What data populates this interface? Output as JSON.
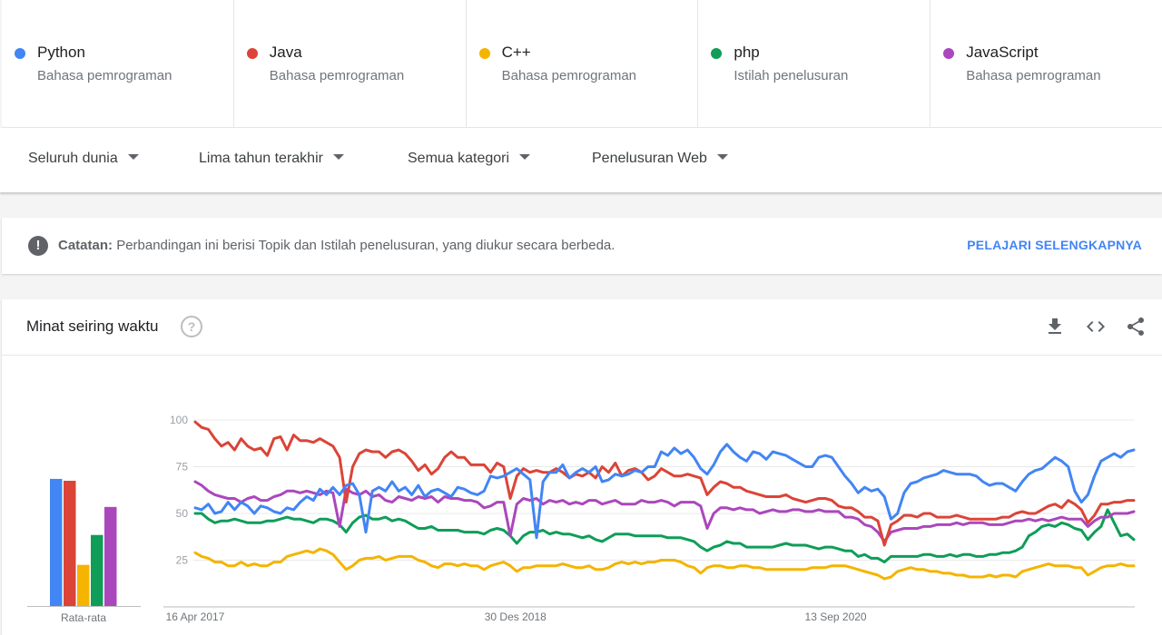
{
  "compare": {
    "terms": [
      {
        "name": "Python",
        "type": "Bahasa pemrograman",
        "color": "#4285f4"
      },
      {
        "name": "Java",
        "type": "Bahasa pemrograman",
        "color": "#db4437"
      },
      {
        "name": "C++",
        "type": "Bahasa pemrograman",
        "color": "#f4b400"
      },
      {
        "name": "php",
        "type": "Istilah penelusuran",
        "color": "#0f9d58"
      },
      {
        "name": "JavaScript",
        "type": "Bahasa pemrograman",
        "color": "#ab47bc"
      }
    ]
  },
  "filters": {
    "region": "Seluruh dunia",
    "time": "Lima tahun terakhir",
    "category": "Semua kategori",
    "search_type": "Penelusuran Web"
  },
  "note": {
    "label": "Catatan:",
    "text": "Perbandingan ini berisi Topik dan Istilah penelusuran, yang diukur secara berbeda.",
    "link": "PELAJARI SELENGKAPNYA"
  },
  "card": {
    "title": "Minat seiring waktu",
    "help_glyph": "?"
  },
  "chart_data": {
    "type": "line",
    "title": "Minat seiring waktu",
    "ylim": [
      0,
      100
    ],
    "yticks": [
      25,
      50,
      75,
      100
    ],
    "grid": true,
    "x_range": [
      "16 Apr 2017",
      "16 Apr 2022"
    ],
    "x_tick_labels": [
      "16 Apr 2017",
      "30 Des 2018",
      "13 Sep 2020"
    ],
    "average": {
      "label": "Rata-rata",
      "values": [
        {
          "name": "Python",
          "value": 68
        },
        {
          "name": "Java",
          "value": 67
        },
        {
          "name": "C++",
          "value": 22
        },
        {
          "name": "php",
          "value": 38
        },
        {
          "name": "JavaScript",
          "value": 53
        }
      ]
    },
    "series": [
      {
        "name": "Python",
        "color": "#4285f4",
        "values": [
          53,
          52,
          55,
          50,
          51,
          56,
          52,
          56,
          54,
          50,
          54,
          53,
          51,
          50,
          53,
          52,
          56,
          59,
          57,
          63,
          60,
          64,
          60,
          65,
          66,
          60,
          40,
          62,
          64,
          62,
          67,
          62,
          64,
          60,
          65,
          59,
          62,
          63,
          61,
          59,
          64,
          63,
          61,
          60,
          62,
          70,
          69,
          70,
          72,
          74,
          71,
          68,
          37,
          67,
          72,
          72,
          76,
          69,
          72,
          74,
          72,
          75,
          67,
          68,
          71,
          70,
          71,
          73,
          72,
          75,
          75,
          83,
          81,
          85,
          82,
          84,
          80,
          74,
          71,
          76,
          83,
          87,
          83,
          80,
          78,
          83,
          82,
          79,
          83,
          82,
          81,
          79,
          77,
          75,
          75,
          80,
          81,
          80,
          75,
          70,
          66,
          61,
          64,
          62,
          63,
          59,
          47,
          50,
          61,
          66,
          67,
          69,
          70,
          71,
          73,
          72,
          71,
          71,
          71,
          70,
          67,
          65,
          66,
          66,
          64,
          62,
          67,
          71,
          73,
          74,
          77,
          80,
          78,
          75,
          62,
          56,
          60,
          70,
          78,
          80,
          82,
          80,
          83,
          84
        ]
      },
      {
        "name": "Java",
        "color": "#db4437",
        "values": [
          99,
          96,
          95,
          90,
          86,
          88,
          84,
          90,
          86,
          84,
          85,
          81,
          90,
          91,
          84,
          92,
          89,
          89,
          88,
          90,
          88,
          86,
          80,
          56,
          75,
          82,
          84,
          83,
          83,
          80,
          83,
          84,
          82,
          78,
          73,
          76,
          71,
          74,
          80,
          83,
          80,
          80,
          76,
          76,
          76,
          72,
          77,
          75,
          58,
          70,
          74,
          72,
          73,
          72,
          72,
          74,
          72,
          69,
          71,
          70,
          72,
          69,
          75,
          72,
          77,
          70,
          73,
          74,
          72,
          68,
          70,
          74,
          72,
          70,
          70,
          71,
          70,
          69,
          60,
          64,
          67,
          66,
          64,
          64,
          62,
          61,
          60,
          59,
          59,
          59,
          60,
          58,
          57,
          56,
          57,
          58,
          58,
          57,
          54,
          53,
          53,
          51,
          48,
          48,
          46,
          33,
          44,
          46,
          49,
          49,
          48,
          50,
          50,
          48,
          48,
          48,
          49,
          48,
          47,
          47,
          47,
          47,
          47,
          48,
          48,
          50,
          51,
          50,
          50,
          52,
          54,
          55,
          53,
          57,
          55,
          52,
          45,
          49,
          55,
          55,
          56,
          56,
          57,
          57
        ]
      },
      {
        "name": "C++",
        "color": "#f4b400",
        "values": [
          29,
          27,
          26,
          24,
          24,
          22,
          22,
          24,
          22,
          23,
          22,
          22,
          24,
          24,
          27,
          28,
          29,
          30,
          29,
          31,
          30,
          28,
          24,
          20,
          22,
          25,
          26,
          26,
          27,
          25,
          26,
          27,
          27,
          27,
          25,
          24,
          22,
          21,
          23,
          23,
          22,
          23,
          22,
          22,
          20,
          22,
          23,
          24,
          22,
          19,
          21,
          21,
          22,
          22,
          22,
          22,
          23,
          22,
          21,
          21,
          22,
          20,
          20,
          21,
          23,
          24,
          23,
          24,
          23,
          24,
          24,
          25,
          25,
          25,
          24,
          22,
          21,
          18,
          21,
          22,
          22,
          21,
          21,
          22,
          22,
          21,
          21,
          20,
          20,
          20,
          20,
          20,
          20,
          20,
          21,
          21,
          21,
          22,
          22,
          22,
          21,
          20,
          19,
          18,
          17,
          15,
          16,
          19,
          20,
          21,
          20,
          20,
          19,
          19,
          18,
          18,
          17,
          17,
          16,
          16,
          16,
          17,
          16,
          17,
          17,
          16,
          19,
          20,
          21,
          22,
          23,
          22,
          22,
          22,
          21,
          21,
          17,
          19,
          21,
          22,
          22,
          23,
          22,
          22
        ]
      },
      {
        "name": "php",
        "color": "#0f9d58",
        "values": [
          50,
          50,
          47,
          45,
          46,
          46,
          47,
          46,
          45,
          45,
          45,
          46,
          46,
          47,
          48,
          47,
          47,
          46,
          45,
          47,
          47,
          46,
          44,
          40,
          45,
          48,
          49,
          47,
          47,
          48,
          46,
          47,
          46,
          44,
          42,
          42,
          43,
          41,
          41,
          41,
          41,
          40,
          40,
          40,
          39,
          41,
          42,
          41,
          38,
          34,
          38,
          40,
          40,
          41,
          39,
          40,
          39,
          39,
          38,
          37,
          38,
          36,
          35,
          37,
          39,
          39,
          39,
          38,
          38,
          38,
          38,
          38,
          37,
          37,
          37,
          36,
          35,
          32,
          30,
          32,
          33,
          35,
          34,
          34,
          32,
          32,
          32,
          32,
          32,
          33,
          34,
          33,
          33,
          33,
          32,
          31,
          32,
          32,
          31,
          30,
          30,
          27,
          28,
          26,
          26,
          24,
          27,
          27,
          27,
          27,
          27,
          28,
          28,
          27,
          27,
          28,
          27,
          28,
          28,
          27,
          27,
          28,
          28,
          29,
          29,
          30,
          32,
          38,
          40,
          43,
          44,
          43,
          45,
          44,
          42,
          41,
          36,
          40,
          43,
          52,
          45,
          38,
          39,
          36
        ]
      },
      {
        "name": "JavaScript",
        "color": "#ab47bc",
        "values": [
          67,
          65,
          62,
          60,
          59,
          58,
          58,
          56,
          58,
          59,
          57,
          57,
          59,
          60,
          62,
          62,
          61,
          62,
          61,
          60,
          62,
          61,
          43,
          63,
          61,
          60,
          62,
          59,
          60,
          57,
          56,
          59,
          58,
          57,
          59,
          58,
          59,
          56,
          59,
          58,
          58,
          57,
          57,
          56,
          53,
          54,
          56,
          56,
          38,
          55,
          58,
          57,
          58,
          55,
          57,
          56,
          57,
          55,
          56,
          55,
          57,
          57,
          55,
          56,
          57,
          55,
          55,
          55,
          57,
          56,
          56,
          57,
          56,
          54,
          56,
          56,
          56,
          54,
          42,
          50,
          53,
          53,
          52,
          53,
          52,
          52,
          50,
          51,
          52,
          51,
          51,
          52,
          52,
          51,
          51,
          52,
          51,
          51,
          51,
          48,
          48,
          47,
          44,
          43,
          40,
          35,
          40,
          41,
          42,
          42,
          42,
          43,
          43,
          44,
          44,
          44,
          45,
          44,
          45,
          45,
          45,
          44,
          44,
          44,
          45,
          46,
          46,
          47,
          46,
          47,
          46,
          47,
          48,
          47,
          47,
          47,
          43,
          46,
          48,
          48,
          50,
          50,
          50,
          51
        ]
      }
    ]
  }
}
